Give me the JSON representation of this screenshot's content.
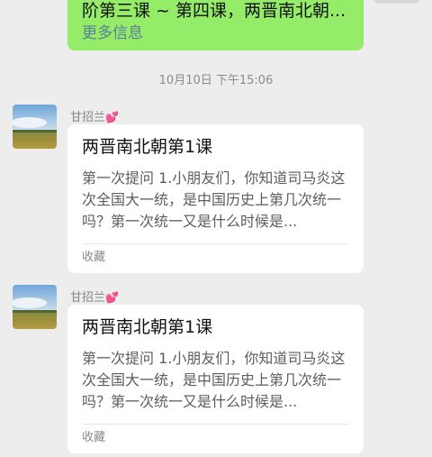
{
  "prev_message": {
    "text": "阶第三课 ~ 第四课，两晋南北朝...",
    "more_link": "更多信息"
  },
  "timestamp": "10月10日 下午15:06",
  "messages": [
    {
      "sender": "甘招兰",
      "card": {
        "title": "两晋南北朝第1课",
        "description": "第一次提问 1.小朋友们，你知道司马炎这次全国大一统，是中国历史上第几次统一吗？第一次统一又是什么时候是...",
        "source": "收藏"
      }
    },
    {
      "sender": "甘招兰",
      "card": {
        "title": "两晋南北朝第1课",
        "description": "第一次提问 1.小朋友们，你知道司马炎这次全国大一统，是中国历史上第几次统一吗？第一次统一又是什么时候是...",
        "source": "收藏"
      }
    }
  ],
  "colors": {
    "background": "#ededed",
    "sent_bubble": "#95ec69",
    "card": "#ffffff",
    "link": "#5a7f9a"
  },
  "icons": [
    "sender-avatar-landscape",
    "heart-emoji"
  ]
}
